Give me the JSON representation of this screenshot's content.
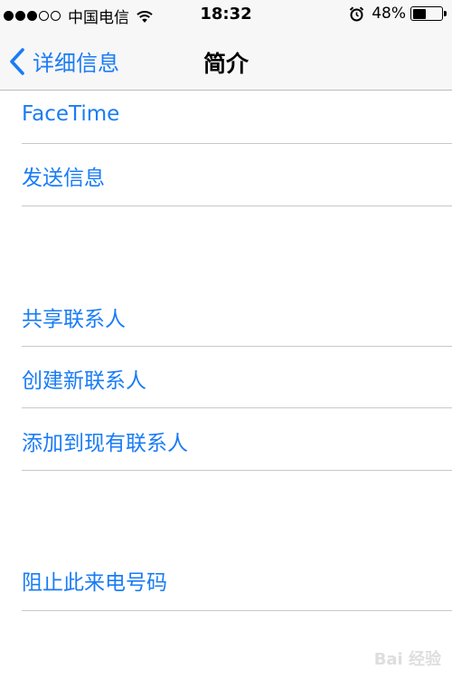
{
  "status_bar": {
    "signal_bars_filled": 3,
    "signal_bars_total": 5,
    "carrier": "中国电信",
    "time": "18:32",
    "battery_percent_text": "48%",
    "battery_level": 0.48,
    "icons": [
      "wifi-icon",
      "alarm-icon",
      "battery-icon"
    ]
  },
  "nav": {
    "back_label": "详细信息",
    "title": "简介"
  },
  "menu": {
    "facetime": "FaceTime",
    "send_message": "发送信息",
    "share_contact": "共享联系人",
    "create_contact": "创建新联系人",
    "add_existing": "添加到现有联系人",
    "block_caller": "阻止此来电号码"
  },
  "colors": {
    "accent": "#1a7cf5",
    "separator": "#c8c7cc",
    "bar_background": "#f7f7f8"
  },
  "watermark": "Bai 经验"
}
